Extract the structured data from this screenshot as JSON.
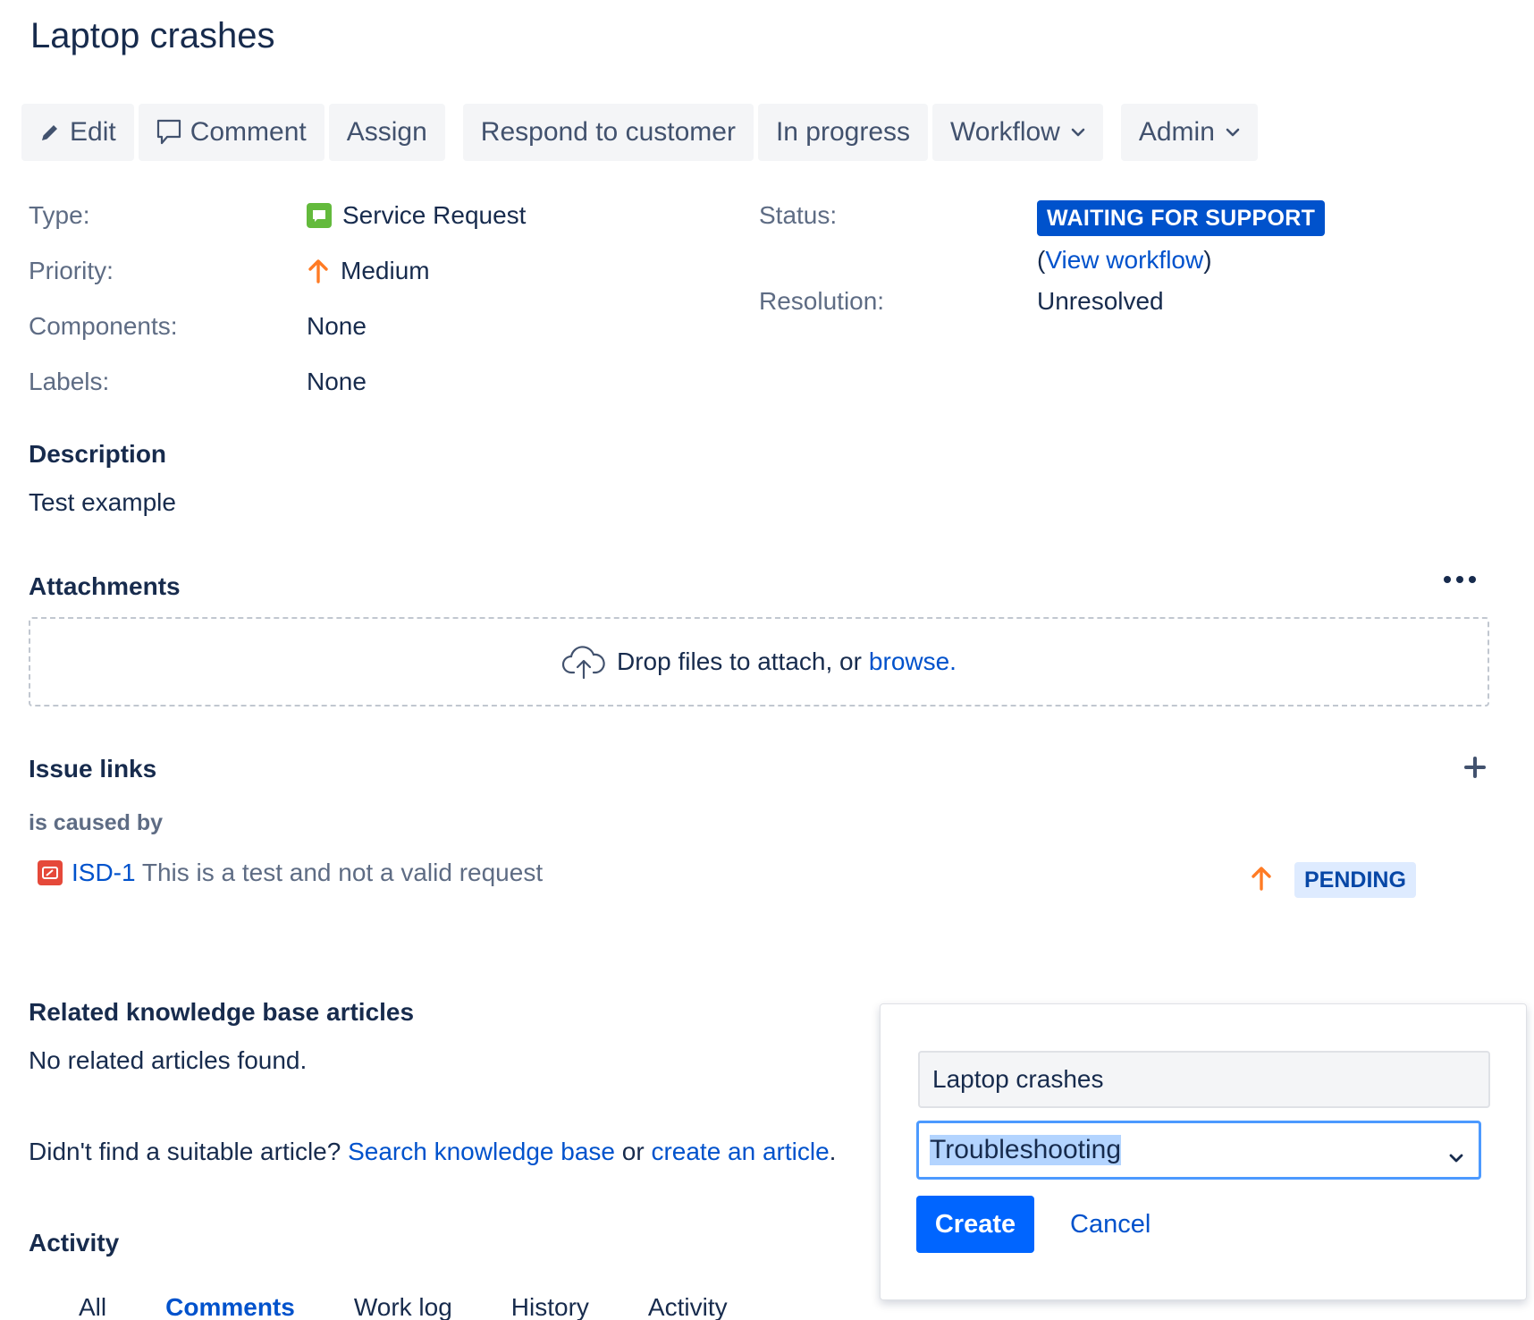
{
  "issue": {
    "title": "Laptop crashes"
  },
  "toolbar": {
    "edit": "Edit",
    "comment": "Comment",
    "assign": "Assign",
    "respond": "Respond to customer",
    "in_progress": "In progress",
    "workflow": "Workflow",
    "admin": "Admin"
  },
  "details": {
    "type_label": "Type:",
    "type_value": "Service Request",
    "priority_label": "Priority:",
    "priority_value": "Medium",
    "components_label": "Components:",
    "components_value": "None",
    "labels_label": "Labels:",
    "labels_value": "None",
    "status_label": "Status:",
    "status_value": "WAITING FOR SUPPORT",
    "view_workflow_open": "(",
    "view_workflow": "View workflow",
    "view_workflow_close": ")",
    "resolution_label": "Resolution:",
    "resolution_value": "Unresolved"
  },
  "description": {
    "heading": "Description",
    "text": "Test example"
  },
  "attachments": {
    "heading": "Attachments",
    "drop_text": "Drop files to attach, or ",
    "browse": "browse."
  },
  "issue_links": {
    "heading": "Issue links",
    "relation": "is caused by",
    "key": "ISD-1",
    "summary": " This is a test and not a valid request",
    "status": "PENDING"
  },
  "kb": {
    "heading": "Related knowledge base articles",
    "none": "No related articles found.",
    "prompt": "Didn't find a suitable article? ",
    "search_link": "Search knowledge base",
    "or": " or ",
    "create_link": "create an article",
    "period": "."
  },
  "activity": {
    "heading": "Activity",
    "tabs": [
      "All",
      "Comments",
      "Work log",
      "History",
      "Activity"
    ],
    "active_tab": "Comments"
  },
  "create_article_popup": {
    "title_value": "Laptop crashes",
    "template_value": "Troubleshooting",
    "create": "Create",
    "cancel": "Cancel"
  },
  "colors": {
    "primary": "#0052cc",
    "status_blue": "#0052cc",
    "pending_bg": "#deebff",
    "priority_medium": "#ff7b24",
    "service_request": "#63ba3c",
    "bug": "#e5493a"
  }
}
